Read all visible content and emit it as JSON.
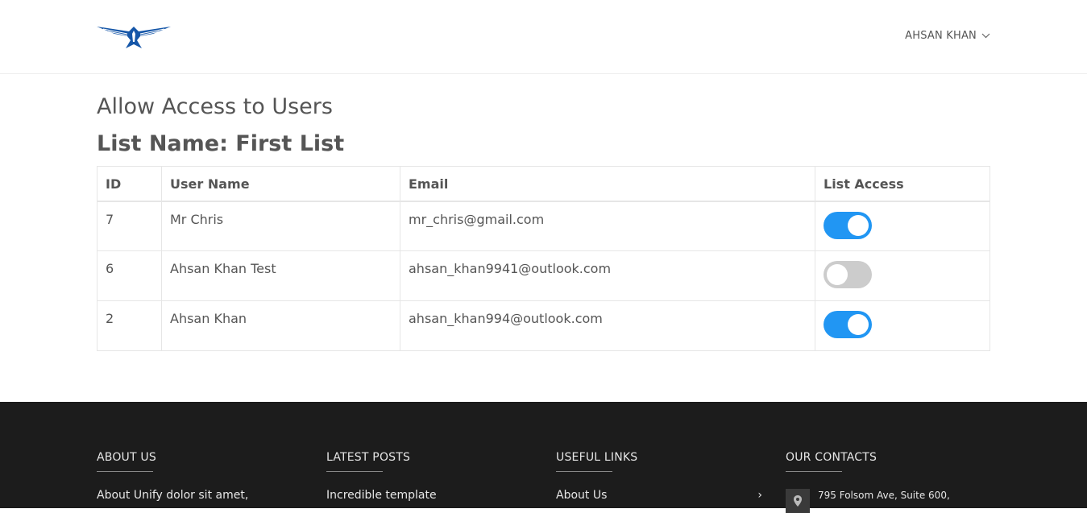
{
  "header": {
    "user_name": "AHSAN KHAN"
  },
  "main": {
    "page_title": "Allow Access to Users",
    "list_name": "List Name: First List",
    "table": {
      "columns": [
        "ID",
        "User Name",
        "Email",
        "List Access"
      ],
      "rows": [
        {
          "id": "7",
          "name": "Mr Chris",
          "email": "mr_chris@gmail.com",
          "access": true
        },
        {
          "id": "6",
          "name": "Ahsan Khan Test",
          "email": "ahsan_khan9941@outlook.com",
          "access": false
        },
        {
          "id": "2",
          "name": "Ahsan Khan",
          "email": "ahsan_khan994@outlook.com",
          "access": true
        }
      ]
    }
  },
  "footer": {
    "about": {
      "heading": "ABOUT US",
      "text": "About Unify dolor sit amet,"
    },
    "posts": {
      "heading": "LATEST POSTS",
      "text": "Incredible template"
    },
    "links": {
      "heading": "USEFUL LINKS",
      "text": "About Us"
    },
    "contacts": {
      "heading": "OUR CONTACTS",
      "text": "795 Folsom Ave, Suite 600,"
    }
  },
  "colors": {
    "toggle_on": "#2196f3",
    "toggle_off": "#cccccc",
    "logo_blue": "#1556a8",
    "footer_bg": "#1c1c1c"
  },
  "icons": [
    "eagle-logo",
    "chevron-down-icon",
    "chevron-right-icon",
    "map-pin-icon"
  ]
}
